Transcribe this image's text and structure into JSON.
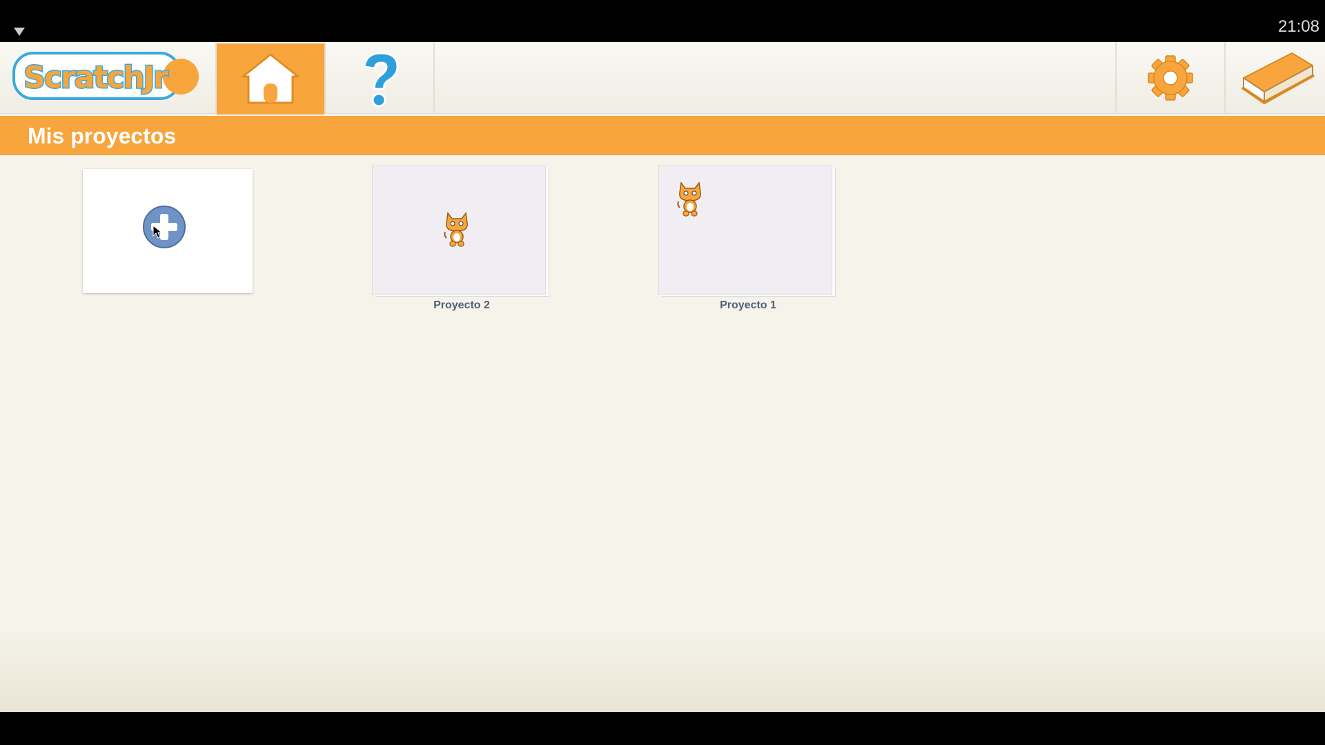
{
  "status_bar": {
    "time": "21:08"
  },
  "app": {
    "logo_text": "ScratchJr"
  },
  "nav": {
    "home_icon": "home-icon",
    "help_icon": "help-icon",
    "settings_icon": "gear-icon",
    "book_icon": "book-icon"
  },
  "section": {
    "title": "Mis proyectos"
  },
  "projects": [
    {
      "name": "Proyecto 2"
    },
    {
      "name": "Proyecto 1"
    }
  ],
  "colors": {
    "accent": "#f7a53c",
    "background": "#f5f3ea",
    "label": "#4f6179",
    "plus": "#6f93c6"
  }
}
